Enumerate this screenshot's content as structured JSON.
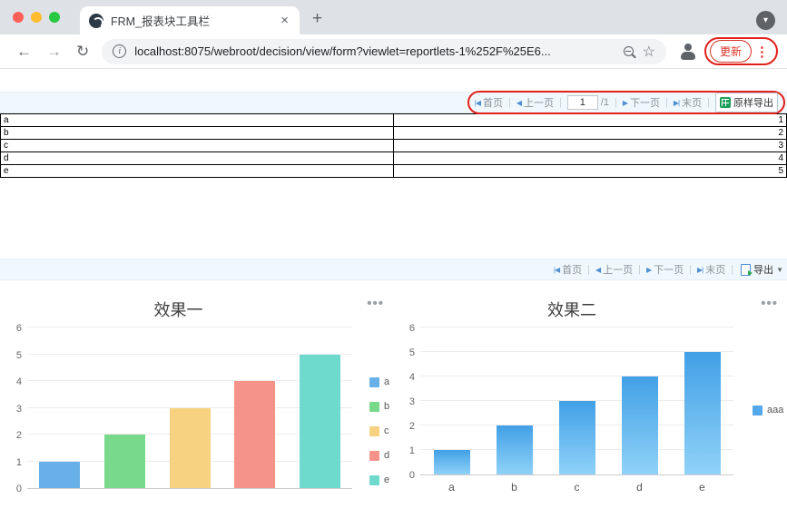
{
  "browser": {
    "tab_title": "FRM_报表块工具栏",
    "url": "localhost:8075/webroot/decision/view/form?viewlet=reportlets-1%252F%25E6...",
    "update_label": "更新"
  },
  "icons": {
    "back": "←",
    "forward": "→",
    "reload": "↻",
    "newtab_plus": "+",
    "tab_close": "×",
    "star": "☆",
    "menu_dots": "⋮",
    "chevron_down": "▾",
    "panel_menu": "•••",
    "first_icon": "|◀",
    "prev_icon": "◀",
    "next_icon": "▶",
    "last_icon": "▶|",
    "caret_down": "▼",
    "sep": "|",
    "info": "i"
  },
  "report_toolbar": {
    "first": "首页",
    "prev": "上一页",
    "page": "1",
    "total": "/1",
    "next": "下一页",
    "last": "末页",
    "export_label": "原样导出"
  },
  "table": {
    "rows": [
      [
        "a",
        "1"
      ],
      [
        "b",
        "2"
      ],
      [
        "c",
        "3"
      ],
      [
        "d",
        "4"
      ],
      [
        "e",
        "5"
      ]
    ]
  },
  "chart_toolbar": {
    "first": "首页",
    "prev": "上一页",
    "next": "下一页",
    "last": "末页",
    "export_label": "导出"
  },
  "chart_data": [
    {
      "type": "bar",
      "title": "效果一",
      "categories": [
        "a",
        "b",
        "c",
        "d",
        "e"
      ],
      "values": [
        1,
        2,
        3,
        4,
        5
      ],
      "colors": [
        "#68b1e8",
        "#79d98b",
        "#f7d280",
        "#f5928a",
        "#6edacd"
      ],
      "legend": [
        {
          "label": "a",
          "color": "#68b1e8"
        },
        {
          "label": "b",
          "color": "#79d98b"
        },
        {
          "label": "c",
          "color": "#f7d280"
        },
        {
          "label": "d",
          "color": "#f5928a"
        },
        {
          "label": "e",
          "color": "#6edacd"
        }
      ],
      "ylim": [
        0,
        6
      ],
      "x_labels_shown": false,
      "grid": true,
      "legend_position": "right"
    },
    {
      "type": "bar",
      "title": "效果二",
      "categories": [
        "a",
        "b",
        "c",
        "d",
        "e"
      ],
      "series": [
        {
          "name": "aaa",
          "values": [
            1,
            2,
            3,
            4,
            5
          ]
        }
      ],
      "bar_color_top": "#42a0e6",
      "bar_color_bottom": "#8fd2f8",
      "legend": [
        {
          "label": "aaa",
          "color": "#54a9ea"
        }
      ],
      "ylim": [
        0,
        6
      ],
      "x_labels_shown": true,
      "grid": true,
      "legend_position": "right"
    }
  ]
}
